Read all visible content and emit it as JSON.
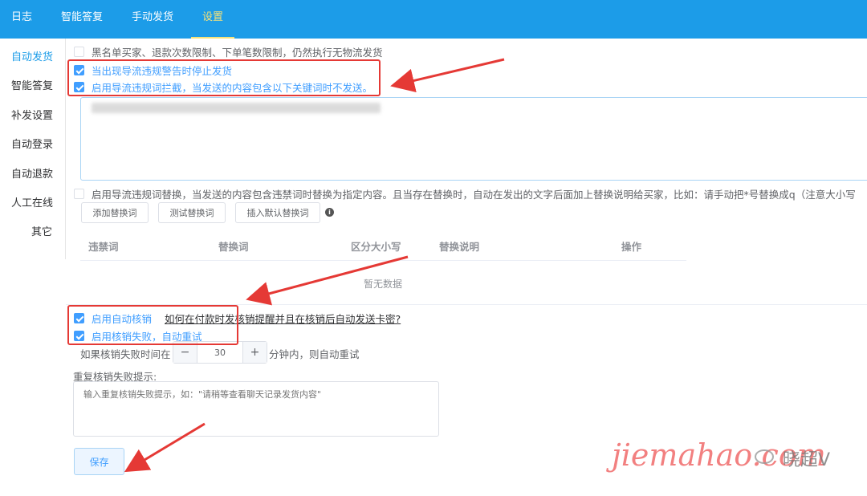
{
  "nav": {
    "tabs": [
      {
        "label": "日志"
      },
      {
        "label": "智能答复"
      },
      {
        "label": "手动发货"
      },
      {
        "label": "设置",
        "active": true
      }
    ]
  },
  "sidebar": {
    "items": [
      {
        "label": "自动发货",
        "active": true
      },
      {
        "label": "智能答复"
      },
      {
        "label": "补发设置"
      },
      {
        "label": "自动登录"
      },
      {
        "label": "自动退款"
      },
      {
        "label": "人工在线"
      },
      {
        "label": "其它"
      }
    ]
  },
  "settings": {
    "blacklist_label": "黑名单买家、退款次数限制、下单笔数限制，仍然执行无物流发货",
    "blacklist_checked": false,
    "stop_on_warning_label": "当出现导流违规警告时停止发货",
    "stop_on_warning_checked": true,
    "intercept_label": "启用导流违规词拦截，当发送的内容包含以下关键词时不发送。",
    "intercept_checked": true,
    "replace_label": "启用导流违规词替换，当发送的内容包含违禁词时替换为指定内容。且当存在替换时，自动在发出的文字后面加上替换说明给买家，比如：请手动把*号替换成q（注意大小写",
    "replace_checked": false
  },
  "buttons": {
    "add": "添加替换词",
    "test": "测试替换词",
    "insert_default": "插入默认替换词",
    "info_icon": "info-icon"
  },
  "table": {
    "headers": [
      "违禁词",
      "替换词",
      "区分大小写",
      "替换说明",
      "操作"
    ],
    "empty_text": "暂无数据"
  },
  "verify": {
    "auto_verify_label": "启用自动核销",
    "auto_verify_checked": true,
    "help_link": "如何在付款时发核销提醒并且在核销后自动发送卡密?",
    "retry_label": "启用核销失败，自动重试",
    "retry_checked": true,
    "retry_prefix": "如果核销失败时间在",
    "retry_minutes": "30",
    "retry_suffix": "分钟内，则自动重试",
    "minus": "−",
    "plus": "+",
    "prompt_label": "重复核销失败提示:",
    "prompt_placeholder": "输入重复核销失败提示，如：\"请稍等查看聊天记录发货内容\""
  },
  "save_label": "保存",
  "watermark": {
    "text": "jiemahao.com",
    "text2": "晓超V"
  },
  "colors": {
    "nav_bg": "#1c9ce8",
    "accent": "#409eff",
    "annotation_red": "#e53935"
  }
}
